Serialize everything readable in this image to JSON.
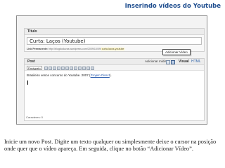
{
  "slide": {
    "title": "Inserindo vídeos do Youtube",
    "caption": "Inicie um novo Post. Digite um texto qualquer ou simplesmente deixe o cursor na posição onde quer que o vídeo apareça. Em seguida, clique no botão “Adicionar Vídeo”."
  },
  "editor": {
    "titulo_label": "Título",
    "post_title": "Curta: Laços (Youtube)",
    "permalink_label": "Link Permanente:",
    "permalink_url": "http://blogdoduvas.wordpress.com/2009/10/09/",
    "permalink_slug": "curta-lacos-youtube",
    "tooltip": "Adicionar Vídeo",
    "post_label": "Post",
    "adicionar_label": "Adicionar mídia",
    "tab_visual": "Visual",
    "tab_html": "HTML",
    "format_select": "Parágrafo",
    "body_text": "Brasileiro vence concurso do Youtube. 2007 (",
    "body_link": "Projeto Direct",
    "body_end": ").",
    "caracteres": "Caracteres: 0"
  },
  "icons": {
    "media_image": "image-icon",
    "media_video": "video-icon",
    "media_audio": "audio-icon",
    "media_generic": "media-icon"
  },
  "colors": {
    "slide_title": "#1f4e8f",
    "link": "#2255aa"
  }
}
